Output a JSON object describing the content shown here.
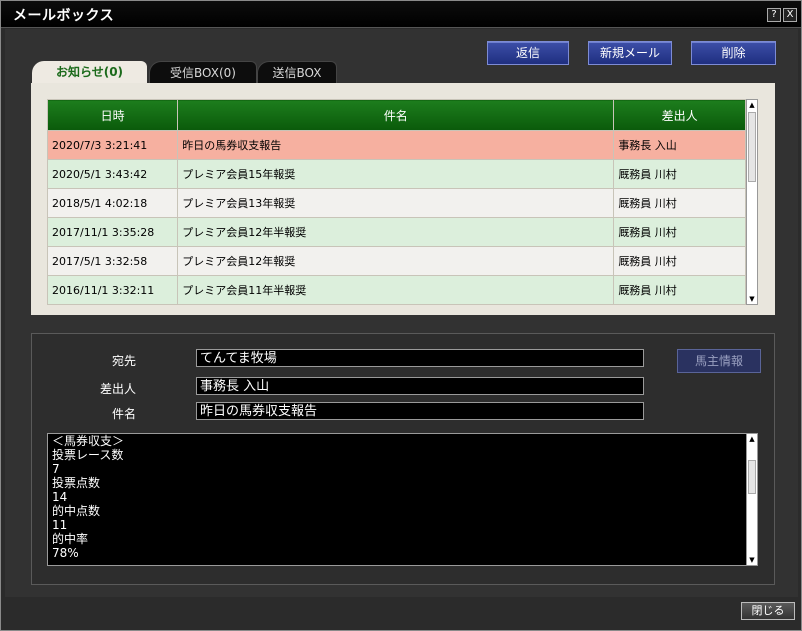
{
  "window": {
    "title": "メールボックス",
    "help_label": "?",
    "close_label": "X"
  },
  "actions": {
    "reply": "返信",
    "new_mail": "新規メール",
    "delete": "削除"
  },
  "tabs": [
    {
      "label": "お知らせ(0)",
      "active": true
    },
    {
      "label": "受信BOX(0)",
      "active": false
    },
    {
      "label": "送信BOX",
      "active": false
    }
  ],
  "list": {
    "headers": [
      "日時",
      "件名",
      "差出人"
    ],
    "rows": [
      {
        "date": "2020/7/3 3:21:41",
        "subject": "昨日の馬券収支報告",
        "sender": "事務長 入山",
        "selected": true
      },
      {
        "date": "2020/5/1 3:43:42",
        "subject": "プレミア会員15年報奨",
        "sender": "厩務員 川村",
        "selected": false
      },
      {
        "date": "2018/5/1 4:02:18",
        "subject": "プレミア会員13年報奨",
        "sender": "厩務員 川村",
        "selected": false
      },
      {
        "date": "2017/11/1 3:35:28",
        "subject": "プレミア会員12年半報奨",
        "sender": "厩務員 川村",
        "selected": false
      },
      {
        "date": "2017/5/1 3:32:58",
        "subject": "プレミア会員12年報奨",
        "sender": "厩務員 川村",
        "selected": false
      },
      {
        "date": "2016/11/1 3:32:11",
        "subject": "プレミア会員11年半報奨",
        "sender": "厩務員 川村",
        "selected": false
      }
    ]
  },
  "detail": {
    "to_label": "宛先",
    "to_value": "てんてま牧場",
    "from_label": "差出人",
    "from_value": "事務長 入山",
    "subject_label": "件名",
    "subject_value": "昨日の馬券収支報告",
    "owner_info_button": "馬主情報",
    "body_lines": [
      "＜馬券収支＞",
      "投票レース数",
      "7",
      "投票点数",
      "14",
      "的中点数",
      "11",
      "的中率",
      "78%"
    ]
  },
  "footer": {
    "close_button": "閉じる"
  },
  "colors": {
    "header_green": "#1d7d1d",
    "selected_row": "#f6b0a0",
    "even_row": "#dcefdc",
    "button_blue": "#2c3d96"
  }
}
